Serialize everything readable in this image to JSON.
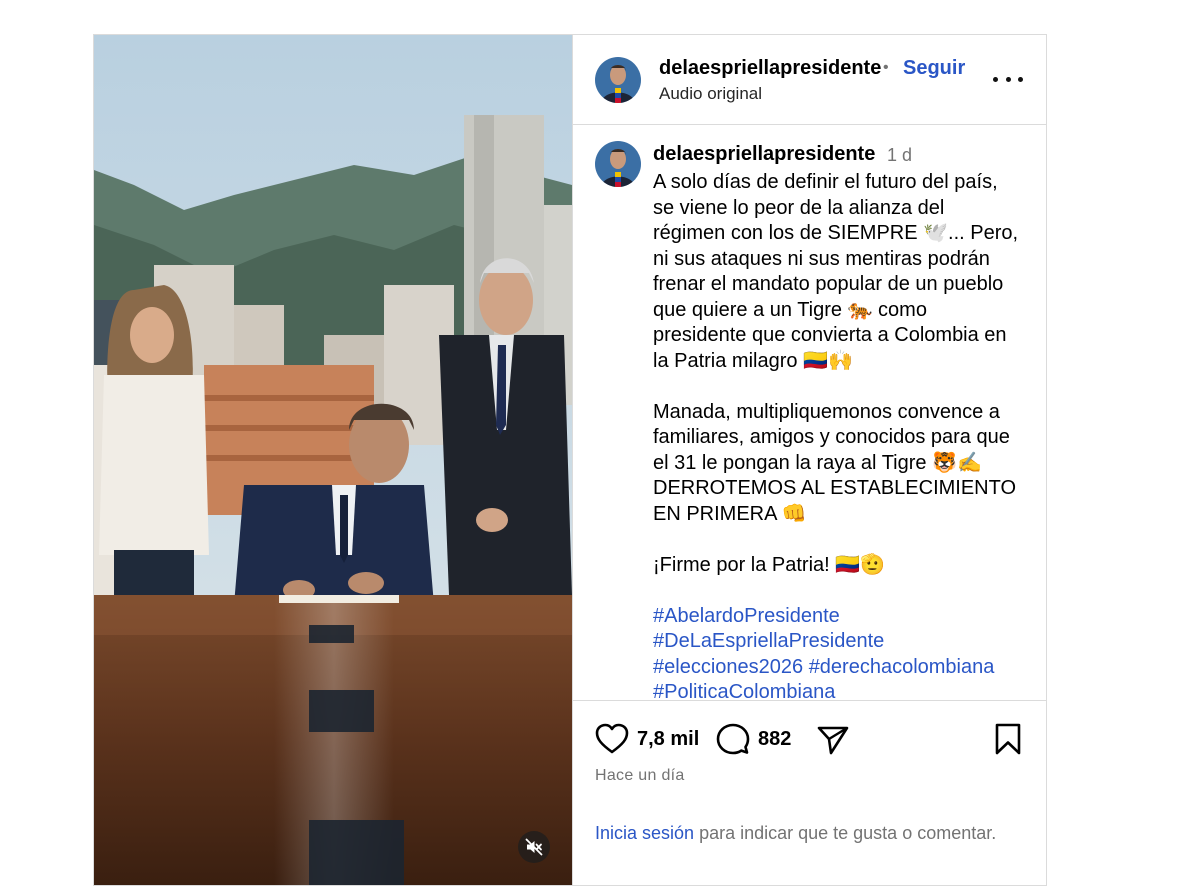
{
  "post": {
    "username": "delaespriellapresidente",
    "follow_label": "Seguir",
    "separator": "•",
    "audio_label": "Audio original",
    "more_icon": "more-horizontal-icon"
  },
  "caption": {
    "username": "delaespriellapresidente",
    "time_ago": "1 d",
    "lines": [
      "A solo días de definir el futuro del país,",
      "se viene lo peor de la alianza del",
      "régimen con los de SIEMPRE 🕊️... Pero,",
      "ni sus ataques ni sus mentiras podrán",
      "frenar el mandato popular de un pueblo",
      "que quiere a un Tigre 🐅 como",
      "presidente que convierta a Colombia en",
      "la Patria milagro 🇨🇴🙌",
      "",
      "Manada, multipliquemonos convence a",
      "familiares, amigos y conocidos para que",
      "el 31 le pongan la raya al Tigre 🐯✍️",
      "DERROTEMOS AL ESTABLECIMIENTO",
      "EN PRIMERA 👊",
      "",
      "¡Firme por la Patria! 🇨🇴🫡"
    ],
    "hashtag_lines": [
      [
        "#AbelardoPresidente"
      ],
      [
        "#DeLaEspriellaPresidente"
      ],
      [
        "#elecciones2026",
        "#derechacolombiana"
      ],
      [
        "#PoliticaColombiana"
      ]
    ]
  },
  "actions": {
    "likes": "7,8 mil",
    "comments": "882",
    "date": "Hace un día",
    "login_link": "Inicia sesión",
    "login_rest": " para indicar que te gusta o comentar."
  },
  "media": {
    "mute_icon": "speaker-muted-icon"
  },
  "colors": {
    "link": "#2a56c6",
    "muted_text": "#737373",
    "border": "#dbdbdb"
  }
}
